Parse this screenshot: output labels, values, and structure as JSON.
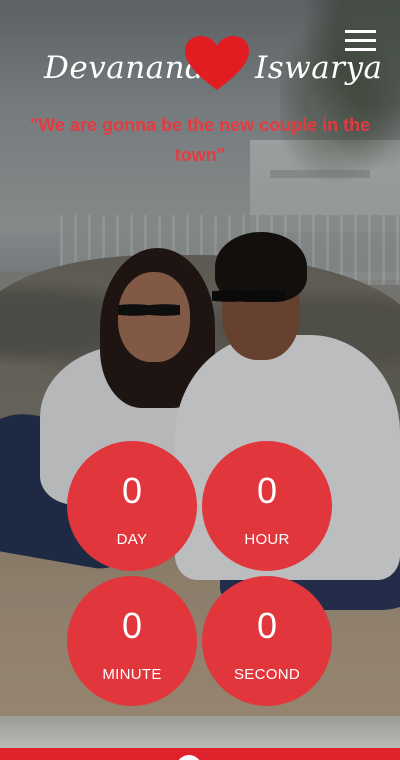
{
  "header": {
    "menu_icon": "hamburger-menu-icon",
    "bride_name": "Devanand",
    "groom_name": "Iswarya",
    "heart_icon": "heart-icon",
    "heart_color": "#e11d22"
  },
  "tagline": "\"We are gonna be the new couple in the town\"",
  "countdown": {
    "accent_color": "#e2363d",
    "day": {
      "value": "0",
      "label": "DAY"
    },
    "hour": {
      "value": "0",
      "label": "HOUR"
    },
    "minute": {
      "value": "0",
      "label": "MINUTE"
    },
    "second": {
      "value": "0",
      "label": "SECOND"
    }
  },
  "footer": {
    "bar_color": "#e0222c"
  }
}
